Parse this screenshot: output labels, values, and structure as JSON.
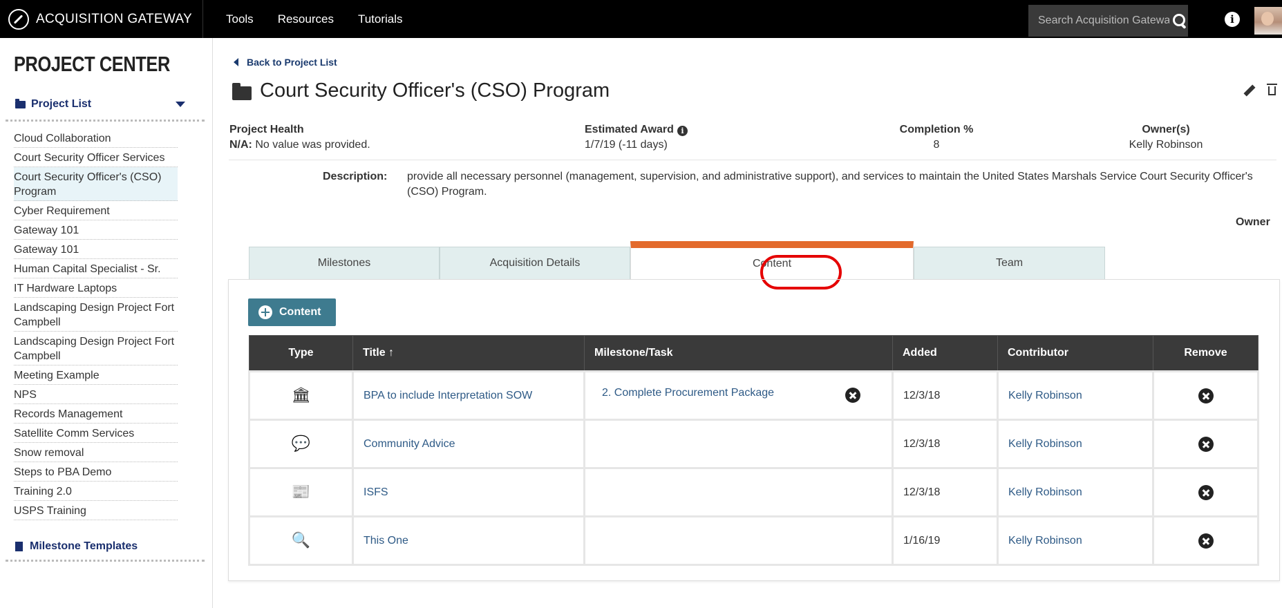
{
  "header": {
    "brand": "ACQUISITION GATEWAY",
    "nav": [
      "Tools",
      "Resources",
      "Tutorials"
    ],
    "search_placeholder": "Search Acquisition Gateway"
  },
  "sidebar": {
    "title": "PROJECT CENTER",
    "project_list_label": "Project List",
    "projects": [
      "Cloud Collaboration",
      "Court Security Officer Services",
      "Court Security Officer's (CSO) Program",
      "Cyber Requirement",
      "Gateway 101",
      "Gateway 101",
      "Human Capital Specialist - Sr.",
      "IT Hardware Laptops",
      "Landscaping Design Project Fort Campbell",
      "Landscaping Design Project Fort Campbell",
      "Meeting Example",
      "NPS",
      "Records Management",
      "Satellite Comm Services",
      "Snow removal",
      "Steps to PBA Demo",
      "Training 2.0",
      "USPS Training"
    ],
    "active_index": 2,
    "milestone_templates_label": "Milestone Templates"
  },
  "main": {
    "back_link": "Back to Project List",
    "title": "Court Security Officer's (CSO) Program",
    "health": {
      "label": "Project Health",
      "value_label": "N/A:",
      "value": "No value was provided."
    },
    "award": {
      "label": "Estimated Award",
      "value": "1/7/19 (-11 days)"
    },
    "completion": {
      "label": "Completion %",
      "value": "8"
    },
    "owners": {
      "label": "Owner(s)",
      "value": "Kelly Robinson"
    },
    "description_label": "Description:",
    "description": "provide all necessary personnel (management, supervision, and administrative support), and services to maintain the United States Marshals Service Court Security Officer's (CSO) Program.",
    "owner_label": "Owner",
    "tabs": [
      "Milestones",
      "Acquisition Details",
      "Content",
      "Team"
    ],
    "active_tab": "Content",
    "add_button": "Content",
    "table": {
      "headers": [
        "Type",
        "Title ↑",
        "Milestone/Task",
        "Added",
        "Contributor",
        "Remove"
      ],
      "rows": [
        {
          "type_icon": "institution-icon",
          "title": "BPA to include Interpretation SOW",
          "milestone": "2. Complete Procurement Package",
          "added": "12/3/18",
          "contributor": "Kelly Robinson"
        },
        {
          "type_icon": "comments-icon",
          "title": "Community Advice",
          "milestone": "",
          "added": "12/3/18",
          "contributor": "Kelly Robinson"
        },
        {
          "type_icon": "newspaper-icon",
          "title": "ISFS",
          "milestone": "",
          "added": "12/3/18",
          "contributor": "Kelly Robinson"
        },
        {
          "type_icon": "search-globe-icon",
          "title": "This One",
          "milestone": "",
          "added": "1/16/19",
          "contributor": "Kelly Robinson"
        }
      ]
    }
  }
}
